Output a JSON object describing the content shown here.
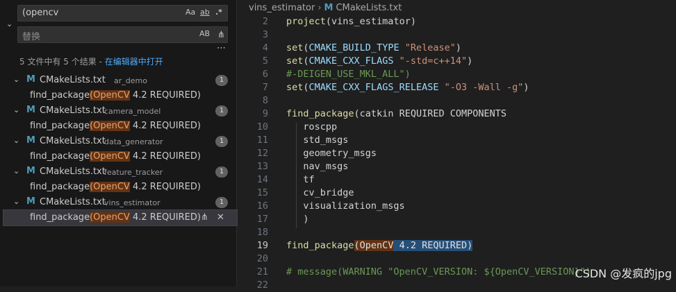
{
  "search": {
    "query": "(opencv",
    "opt_case": "Aa",
    "opt_word": "ab",
    "opt_regex": ".*",
    "replace_placeholder": "替换",
    "opt_preserve_case": "AB",
    "summary_text": "5 文件中有 5 个结果 - ",
    "summary_link": "在编辑器中打开",
    "results": [
      {
        "file": "CMakeLists.txt",
        "dir": "ar_demo",
        "count": "1",
        "match_pre": "find_package",
        "match_hl": "(OpenCV",
        "match_post": " 4.2 REQUIRED)"
      },
      {
        "file": "CMakeLists.txt",
        "dir": "camera_model",
        "count": "1",
        "match_pre": "find_package",
        "match_hl": "(OpenCV",
        "match_post": " 4.2 REQUIRED)"
      },
      {
        "file": "CMakeLists.txt",
        "dir": "data_generator",
        "count": "1",
        "match_pre": "find_package",
        "match_hl": "(OpenCV",
        "match_post": " 4.2 REQUIRED)"
      },
      {
        "file": "CMakeLists.txt",
        "dir": "feature_tracker",
        "count": "1",
        "match_pre": "find_package",
        "match_hl": "(OpenCV",
        "match_post": " 4.2 REQUIRED)"
      },
      {
        "file": "CMakeLists.txt",
        "dir": "vins_estimator",
        "count": "1",
        "match_pre": "find_package",
        "match_hl": "(OpenCV",
        "match_post": " 4.2 REQUIRED)"
      }
    ]
  },
  "breadcrumb": {
    "folder": "vins_estimator",
    "file": "CMakeLists.txt"
  },
  "editor": {
    "lines": [
      {
        "n": "2",
        "parts": [
          [
            "fn",
            "project"
          ],
          [
            "pl",
            "(vins_estimator)"
          ]
        ]
      },
      {
        "n": "3",
        "parts": []
      },
      {
        "n": "4",
        "parts": [
          [
            "fn",
            "set"
          ],
          [
            "pl",
            "("
          ],
          [
            "var",
            "CMAKE_BUILD_TYPE"
          ],
          [
            "pl",
            " "
          ],
          [
            "str",
            "\"Release\""
          ],
          [
            "pl",
            ")"
          ]
        ]
      },
      {
        "n": "5",
        "parts": [
          [
            "fn",
            "set"
          ],
          [
            "pl",
            "("
          ],
          [
            "var",
            "CMAKE_CXX_FLAGS"
          ],
          [
            "pl",
            " "
          ],
          [
            "str",
            "\"-std=c++14\""
          ],
          [
            "pl",
            ")"
          ]
        ]
      },
      {
        "n": "6",
        "parts": [
          [
            "cmt",
            "#-DEIGEN_USE_MKL_ALL\")"
          ]
        ]
      },
      {
        "n": "7",
        "parts": [
          [
            "fn",
            "set"
          ],
          [
            "pl",
            "("
          ],
          [
            "var",
            "CMAKE_CXX_FLAGS_RELEASE"
          ],
          [
            "pl",
            " "
          ],
          [
            "str",
            "\"-O3 -Wall -g\""
          ],
          [
            "pl",
            ")"
          ]
        ]
      },
      {
        "n": "8",
        "parts": []
      },
      {
        "n": "9",
        "parts": [
          [
            "fn",
            "find_package"
          ],
          [
            "pl",
            "(catkin REQUIRED COMPONENTS"
          ]
        ]
      },
      {
        "n": "10",
        "parts": [
          [
            "pl",
            "   roscpp"
          ]
        ]
      },
      {
        "n": "11",
        "parts": [
          [
            "pl",
            "   std_msgs"
          ]
        ]
      },
      {
        "n": "12",
        "parts": [
          [
            "pl",
            "   geometry_msgs"
          ]
        ]
      },
      {
        "n": "13",
        "parts": [
          [
            "pl",
            "   nav_msgs"
          ]
        ]
      },
      {
        "n": "14",
        "parts": [
          [
            "pl",
            "   tf"
          ]
        ]
      },
      {
        "n": "15",
        "parts": [
          [
            "pl",
            "   cv_bridge"
          ]
        ]
      },
      {
        "n": "16",
        "parts": [
          [
            "pl",
            "   visualization_msgs"
          ]
        ]
      },
      {
        "n": "17",
        "parts": [
          [
            "pl",
            "   )"
          ]
        ]
      },
      {
        "n": "18",
        "parts": []
      },
      {
        "n": "19",
        "parts": [
          [
            "fn",
            "find_package"
          ],
          [
            "mhl",
            "(OpenCV"
          ],
          [
            "selhl",
            " 4.2 REQUIRED)"
          ]
        ]
      },
      {
        "n": "20",
        "parts": []
      },
      {
        "n": "21",
        "parts": [
          [
            "cmt",
            "# message(WARNING \"OpenCV_VERSION: ${OpenCV_VERSION}\")"
          ]
        ]
      },
      {
        "n": "22",
        "parts": []
      }
    ]
  },
  "watermark": "CSDN @发疯的jpg"
}
